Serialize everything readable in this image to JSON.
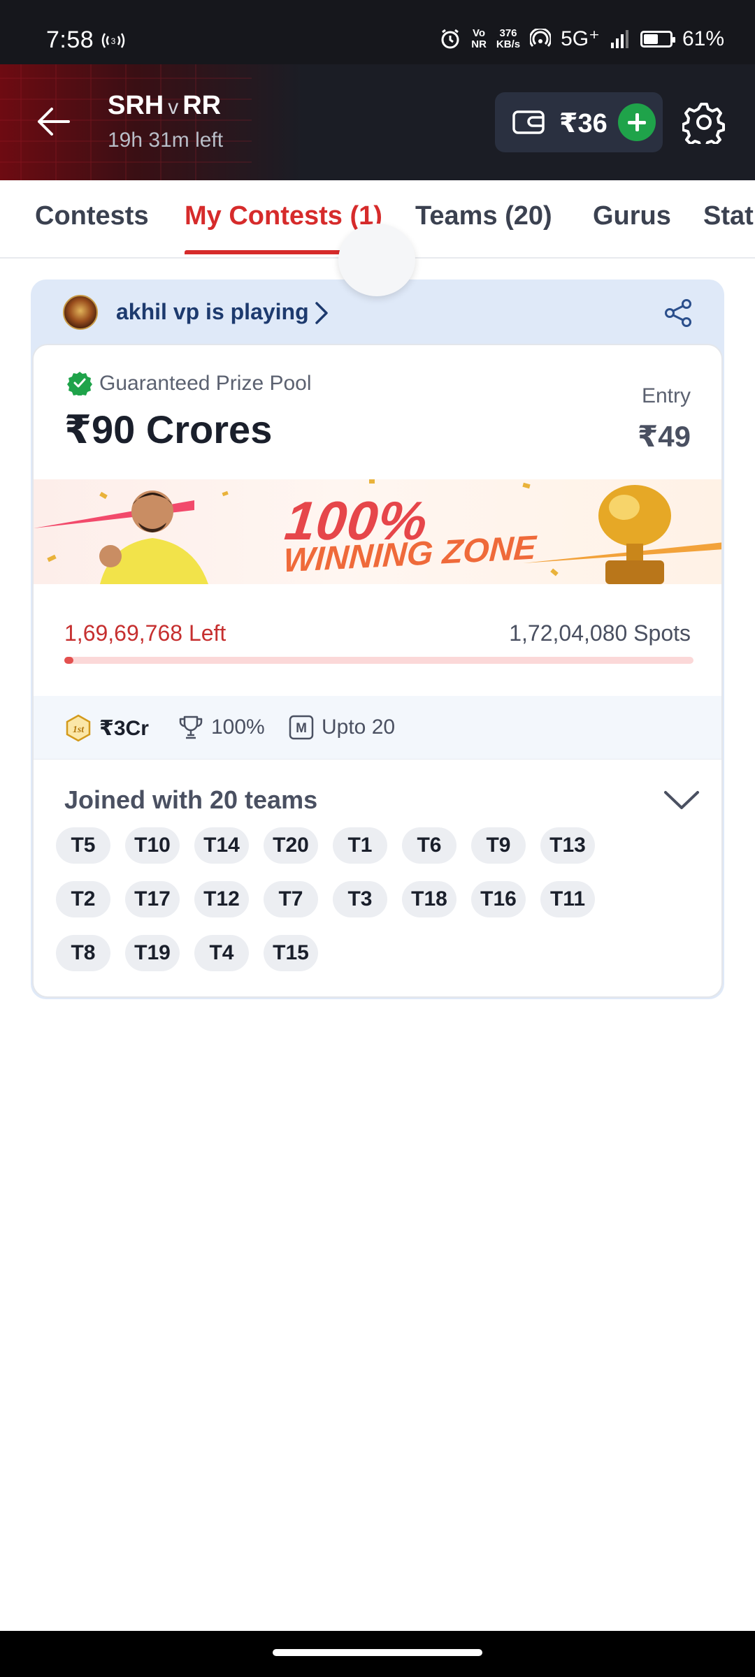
{
  "status_bar": {
    "time": "7:58",
    "network_speed_top": "376",
    "network_speed_bottom": "KB/s",
    "vonr_top": "Vo",
    "vonr_bottom": "NR",
    "signal": "5G⁺",
    "battery": "61%",
    "battery_level": 0.61
  },
  "header": {
    "team_a": "SRH",
    "versus": "v",
    "team_b": "RR",
    "time_left": "19h 31m left",
    "wallet_amount": "₹36"
  },
  "tabs": [
    {
      "label": "Contests",
      "active": false
    },
    {
      "label": "My Contests (1)",
      "active": true
    },
    {
      "label": "Teams (20)",
      "active": false
    },
    {
      "label": "Gurus",
      "active": false
    },
    {
      "label": "Stat",
      "active": false
    }
  ],
  "contest": {
    "player_text": "akhil vp is playing",
    "guaranteed_label": "Guaranteed Prize Pool",
    "prize_pool": "₹90 Crores",
    "entry_label": "Entry",
    "entry_fee": "₹49",
    "banner_line1": "100%",
    "banner_line2": "WINNING ZONE",
    "spots_left": "1,69,69,768 Left",
    "total_spots": "1,72,04,080 Spots",
    "fill_fraction": 0.014,
    "first_prize_badge": "1st",
    "first_prize": "₹3Cr",
    "winning_percent": "100%",
    "max_teams_badge": "M",
    "max_teams": "Upto 20",
    "joined_text": "Joined with 20 teams",
    "teams": [
      "T5",
      "T10",
      "T14",
      "T20",
      "T1",
      "T6",
      "T9",
      "T13",
      "T2",
      "T17",
      "T12",
      "T7",
      "T3",
      "T18",
      "T16",
      "T11",
      "T8",
      "T19",
      "T4",
      "T15"
    ]
  },
  "colors": {
    "accent_red": "#d62b2b",
    "add_green": "#1fa34a",
    "header_dark": "#1b1d25"
  }
}
